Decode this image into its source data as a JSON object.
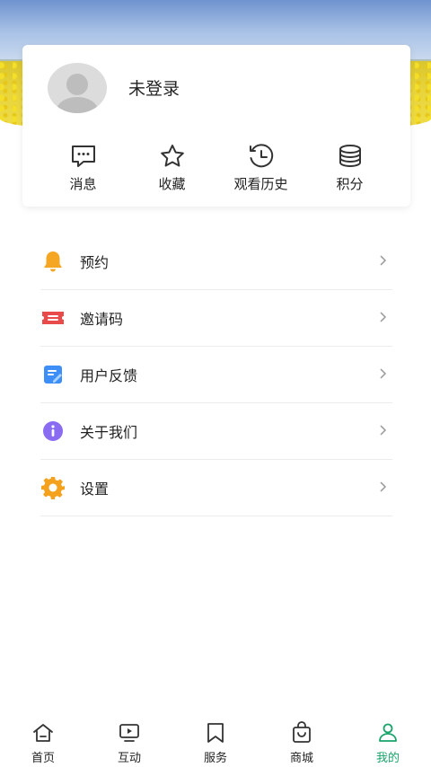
{
  "profile": {
    "login_text": "未登录"
  },
  "quick_actions": [
    {
      "label": "消息",
      "icon": "message-icon"
    },
    {
      "label": "收藏",
      "icon": "star-icon"
    },
    {
      "label": "观看历史",
      "icon": "history-icon"
    },
    {
      "label": "积分",
      "icon": "coins-icon"
    }
  ],
  "menu": [
    {
      "label": "预约",
      "icon": "bell-icon",
      "color": "#f5a623"
    },
    {
      "label": "邀请码",
      "icon": "ticket-icon",
      "color": "#e94b4b"
    },
    {
      "label": "用户反馈",
      "icon": "feedback-icon",
      "color": "#3e8ef7"
    },
    {
      "label": "关于我们",
      "icon": "info-icon",
      "color": "#8a6cf3"
    },
    {
      "label": "设置",
      "icon": "gear-icon",
      "color": "#f4a11d"
    }
  ],
  "bottom_nav": [
    {
      "label": "首页",
      "icon": "home-icon",
      "active": false
    },
    {
      "label": "互动",
      "icon": "tv-icon",
      "active": false
    },
    {
      "label": "服务",
      "icon": "bookmark-icon",
      "active": false
    },
    {
      "label": "商城",
      "icon": "shop-bag-icon",
      "active": false
    },
    {
      "label": "我的",
      "icon": "profile-icon",
      "active": true
    }
  ],
  "colors": {
    "accent": "#19a36b"
  }
}
